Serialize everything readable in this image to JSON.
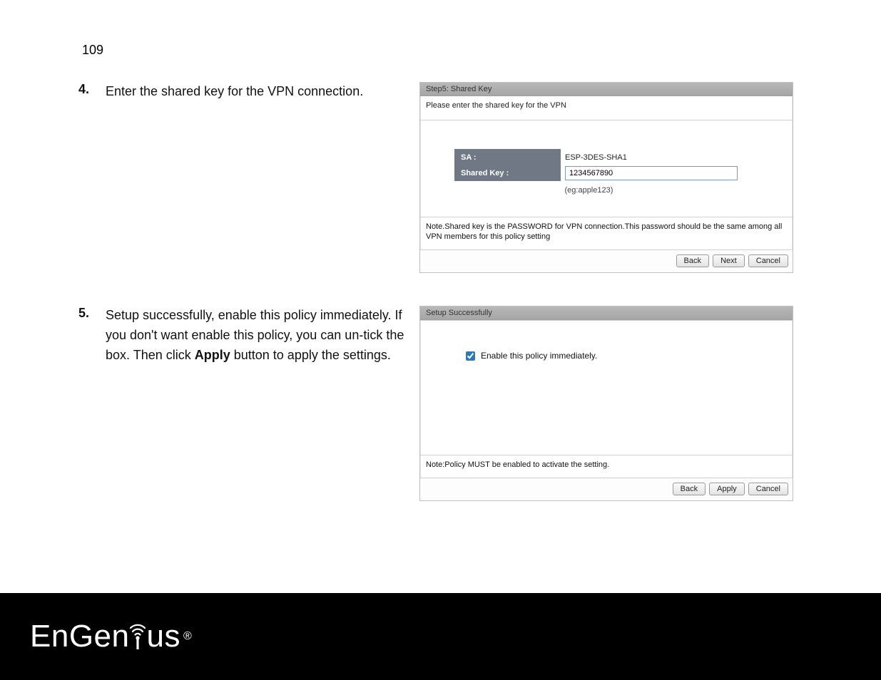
{
  "page_number": "109",
  "steps": [
    {
      "num": "4.",
      "text": "Enter the shared key for the VPN connection."
    },
    {
      "num": "5.",
      "text_pre": "Setup successfully, enable this policy immediately. If you don't want enable this policy, you can un-tick the box. Then click ",
      "text_bold": "Apply",
      "text_post": " button to apply the settings."
    }
  ],
  "panel1": {
    "title": "Step5: Shared Key",
    "subtitle": "Please enter the shared key for the VPN",
    "rows": {
      "sa_label": "SA :",
      "sa_value": "ESP-3DES-SHA1",
      "key_label": "Shared Key :",
      "key_value": "1234567890",
      "example": "(eg:apple123)"
    },
    "note": "Note.Shared key is the PASSWORD for VPN connection.This password should be the same among all VPN members for this policy setting",
    "buttons": {
      "back": "Back",
      "next": "Next",
      "cancel": "Cancel"
    }
  },
  "panel2": {
    "title": "Setup Successfully",
    "checkbox_label": "Enable this policy immediately.",
    "checkbox_checked": true,
    "note": "Note:Policy MUST be enabled to activate the setting.",
    "buttons": {
      "back": "Back",
      "apply": "Apply",
      "cancel": "Cancel"
    }
  },
  "logo": {
    "text_left": "EnGen",
    "text_right": "us",
    "r": "®"
  }
}
